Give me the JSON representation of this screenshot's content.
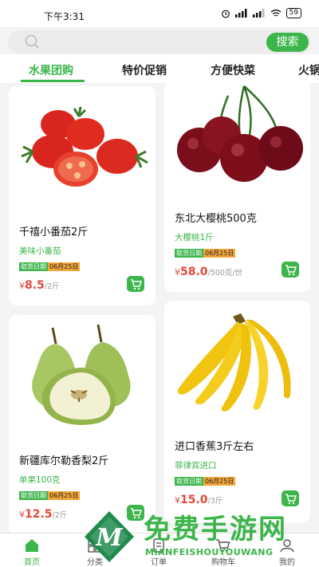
{
  "status_bar": {
    "time": "下午3:31",
    "battery": "59"
  },
  "search": {
    "placeholder": "",
    "button_label": "搜索"
  },
  "tabs": [
    "水果团购",
    "特价促销",
    "方便快菜",
    "火锅"
  ],
  "products": [
    {
      "name": "千禧小番茄2斤",
      "subtitle": "美味小番茄",
      "pickup_label": "取货日期",
      "pickup_date": "06月25日",
      "currency": "¥",
      "price": "8.5",
      "unit": "/2斤",
      "image": "cherry-tomato"
    },
    {
      "name": "东北大樱桃500克",
      "subtitle": "大樱桃1斤",
      "pickup_label": "取货日期",
      "pickup_date": "06月25日",
      "currency": "¥",
      "price": "58.0",
      "unit": "/500克/份",
      "image": "cherry"
    },
    {
      "name": "新疆库尔勒香梨2斤",
      "subtitle": "单果100克",
      "pickup_label": "取货日期",
      "pickup_date": "06月25日",
      "currency": "¥",
      "price": "12.5",
      "unit": "/2斤",
      "image": "pear"
    },
    {
      "name": "进口香蕉3斤左右",
      "subtitle": "菲律宾进口",
      "pickup_label": "取货日期",
      "pickup_date": "06月25日",
      "currency": "¥",
      "price": "15.0",
      "unit": "/3斤",
      "image": "banana"
    }
  ],
  "bottom_nav": [
    {
      "label": "首页",
      "icon": "home-icon",
      "active": true
    },
    {
      "label": "分类",
      "icon": "category-icon",
      "active": false
    },
    {
      "label": "订单",
      "icon": "order-icon",
      "active": false
    },
    {
      "label": "购物车",
      "icon": "cart-icon",
      "active": false
    },
    {
      "label": "我的",
      "icon": "user-icon",
      "active": false
    }
  ],
  "watermark": {
    "title": "免费手游网",
    "subtitle": "MIANFEISHOUYOUWANG",
    "logo_letter": "M"
  },
  "colors": {
    "accent": "#3cb54a",
    "price": "#e04a3a",
    "pickup_date_bg": "#f3a63a"
  }
}
